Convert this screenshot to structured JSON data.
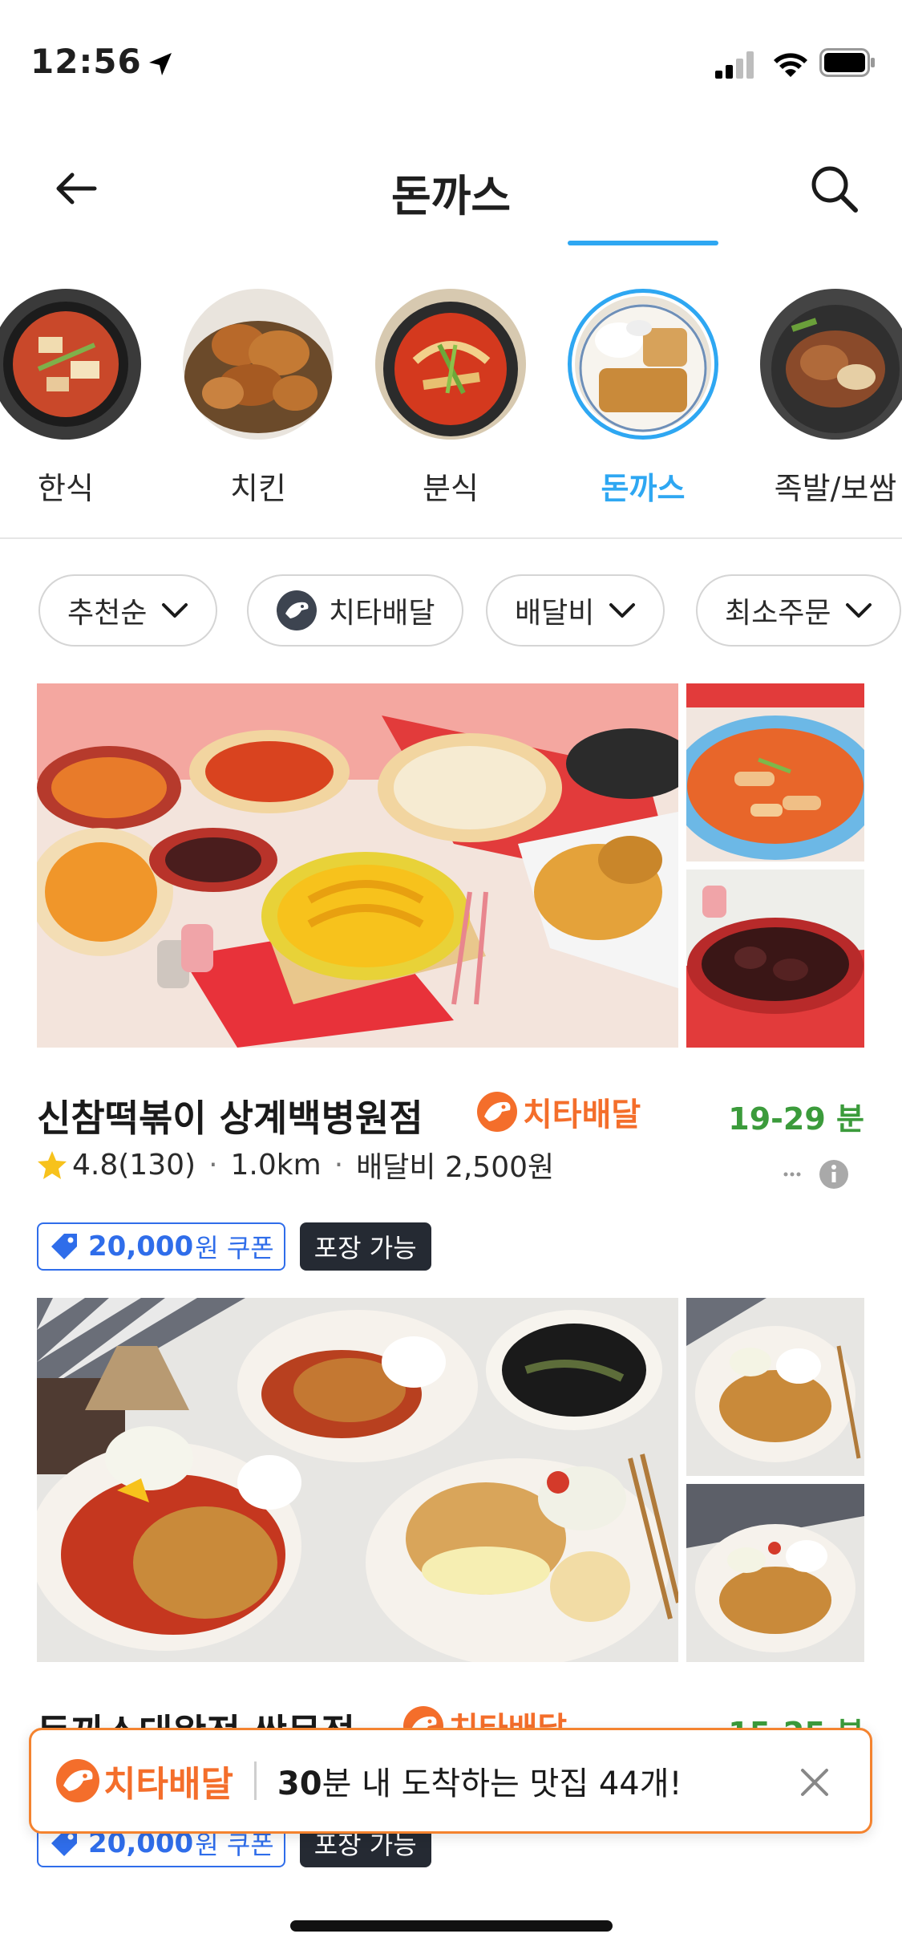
{
  "status_bar": {
    "time": "12:56"
  },
  "header": {
    "title": "돈까스"
  },
  "categories": [
    {
      "label": "한식",
      "active": false
    },
    {
      "label": "치킨",
      "active": false
    },
    {
      "label": "분식",
      "active": false
    },
    {
      "label": "돈까스",
      "active": true
    },
    {
      "label": "족발/보쌈",
      "active": false
    }
  ],
  "filters": [
    {
      "label": "추천순"
    },
    {
      "label": "치타배달"
    },
    {
      "label": "배달비"
    },
    {
      "label": "최소주문"
    }
  ],
  "restaurants": [
    {
      "name": "신참떡볶이 상계백병원점",
      "badge": "치타배달",
      "time": "19-29 분",
      "rating": "4.8(130)",
      "distance": "1.0km",
      "delivery_fee": "배달비 2,500원",
      "coupon_amount": "20,000",
      "coupon_unit": "원 쿠폰",
      "pickup": "포장 가능"
    },
    {
      "name": "돈까스대왕전 쌍문점",
      "badge": "치타배달",
      "time": "15-25 분",
      "coupon_amount": "20,000",
      "coupon_unit": "원 쿠폰",
      "pickup": "포장 가능"
    }
  ],
  "banner": {
    "logo": "치타배달",
    "text_bold": "30",
    "text_rest": "분 내 도착하는 맛집 44개!"
  },
  "colors": {
    "accent_blue": "#2ea7f2",
    "cheetah_orange": "#f46e2b",
    "time_green": "#3b9b3b",
    "coupon_blue": "#2f6dea"
  }
}
